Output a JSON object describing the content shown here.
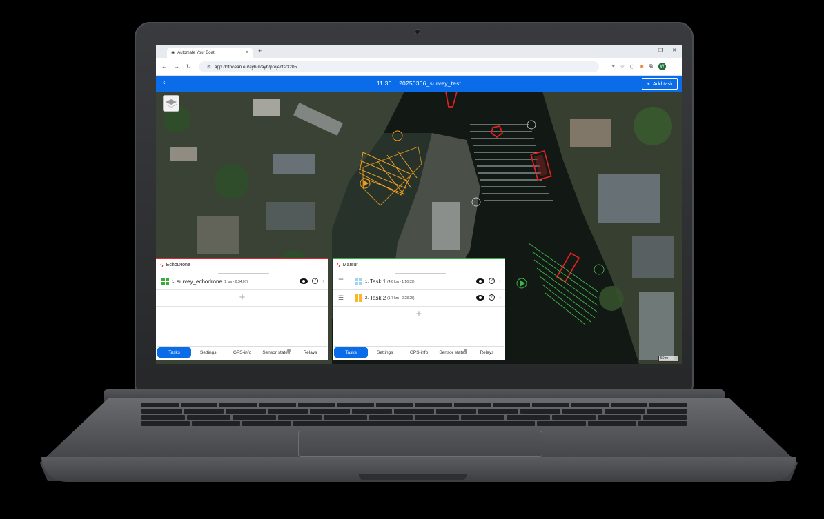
{
  "browser": {
    "tab_title": "Automate Your Boat",
    "url": "app.dotocean.eu/ayb/#/ayb/projects/3205",
    "profile_initial": "W"
  },
  "app": {
    "time": "11:30",
    "project": "20250306_survey_test",
    "add_task_label": "Add task",
    "scale_label": "50 m"
  },
  "panels": [
    {
      "vessel": "EchoDrone",
      "status_color": "#e0262b",
      "tasks": [
        {
          "num": "1.",
          "name": "survey_echodrone",
          "meta": "(2 km - 0:34:07)",
          "color": "#3daa3d"
        }
      ],
      "tabs": [
        "Tasks",
        "Settings",
        "GPS-info",
        "Sensor states",
        "Relays"
      ],
      "active_tab": "Tasks"
    },
    {
      "vessel": "Marsur",
      "status_color": "#2fb13f",
      "tasks": [
        {
          "num": "1.",
          "name": "Task 1",
          "meta": "(4.6 km - 1:16:39)",
          "color": "#9fd3f0"
        },
        {
          "num": "2.",
          "name": "Task 2",
          "meta": "(1.7 km - 0:28:25)",
          "color": "#f5b82e"
        }
      ],
      "tabs": [
        "Tasks",
        "Settings",
        "GPS-info",
        "Sensor states",
        "Relays"
      ],
      "active_tab": "Tasks"
    }
  ],
  "colors": {
    "accent": "#0a6ce8",
    "survey_orange": "#f0a020",
    "survey_green": "#3fb84a",
    "survey_white": "#d8e4ec",
    "zone_red": "#e02020"
  },
  "icons": [
    "back-icon",
    "add-icon",
    "layers-icon",
    "lightning-icon",
    "drag-handle-icon",
    "visibility-icon",
    "help-icon",
    "chevron-right-icon",
    "add-task-plus-icon"
  ]
}
